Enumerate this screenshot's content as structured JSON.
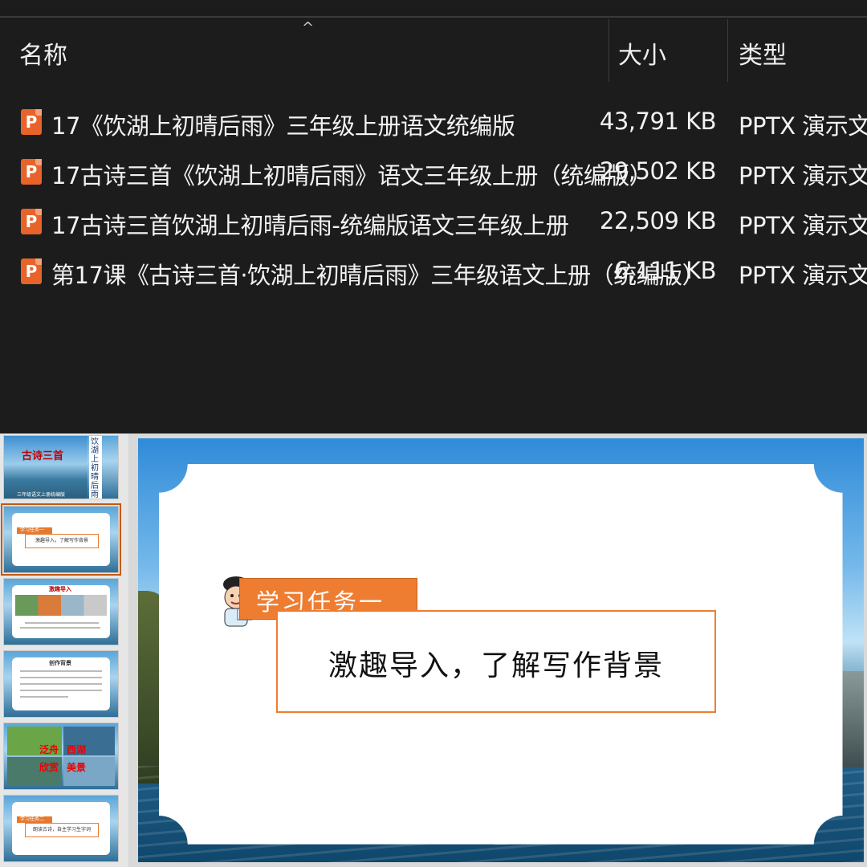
{
  "explorer": {
    "columns": {
      "name": "名称",
      "size": "大小",
      "type": "类型"
    },
    "files": [
      {
        "icon": "powerpoint-file-icon",
        "name": "17《饮湖上初晴后雨》三年级上册语文统编版",
        "size": "43,791 KB",
        "type": "PPTX 演示文稿"
      },
      {
        "icon": "powerpoint-file-icon",
        "name": "17古诗三首《饮湖上初晴后雨》语文三年级上册（统编版）",
        "size": "29,502 KB",
        "type": "PPTX 演示文稿"
      },
      {
        "icon": "powerpoint-file-icon",
        "name": "17古诗三首饮湖上初晴后雨-统编版语文三年级上册",
        "size": "22,509 KB",
        "type": "PPTX 演示文稿"
      },
      {
        "icon": "powerpoint-file-icon",
        "name": "第17课《古诗三首·饮湖上初晴后雨》三年级语文上册（统编版）",
        "size": "6,111 KB",
        "type": "PPTX 演示文稿"
      }
    ]
  },
  "presentation": {
    "thumbnails": [
      {
        "title": "古诗三首",
        "side": "饮湖上初晴后雨",
        "sub": "三年级语文上册统编版"
      },
      {
        "badge": "学习任务一",
        "box": "激趣导入，了解写作背景"
      },
      {
        "title": "激趣导入"
      },
      {
        "title": "创作背景"
      },
      {
        "labels": [
          "泛舟",
          "西湖",
          "欣赏",
          "美景"
        ]
      },
      {
        "badge": "学习任务二",
        "box": "朗读古诗，自主学习生字词"
      }
    ],
    "slide": {
      "badge": "学习任务一",
      "task": "激趣导入，了解写作背景"
    },
    "colors": {
      "accent": "#ee7d31"
    }
  }
}
